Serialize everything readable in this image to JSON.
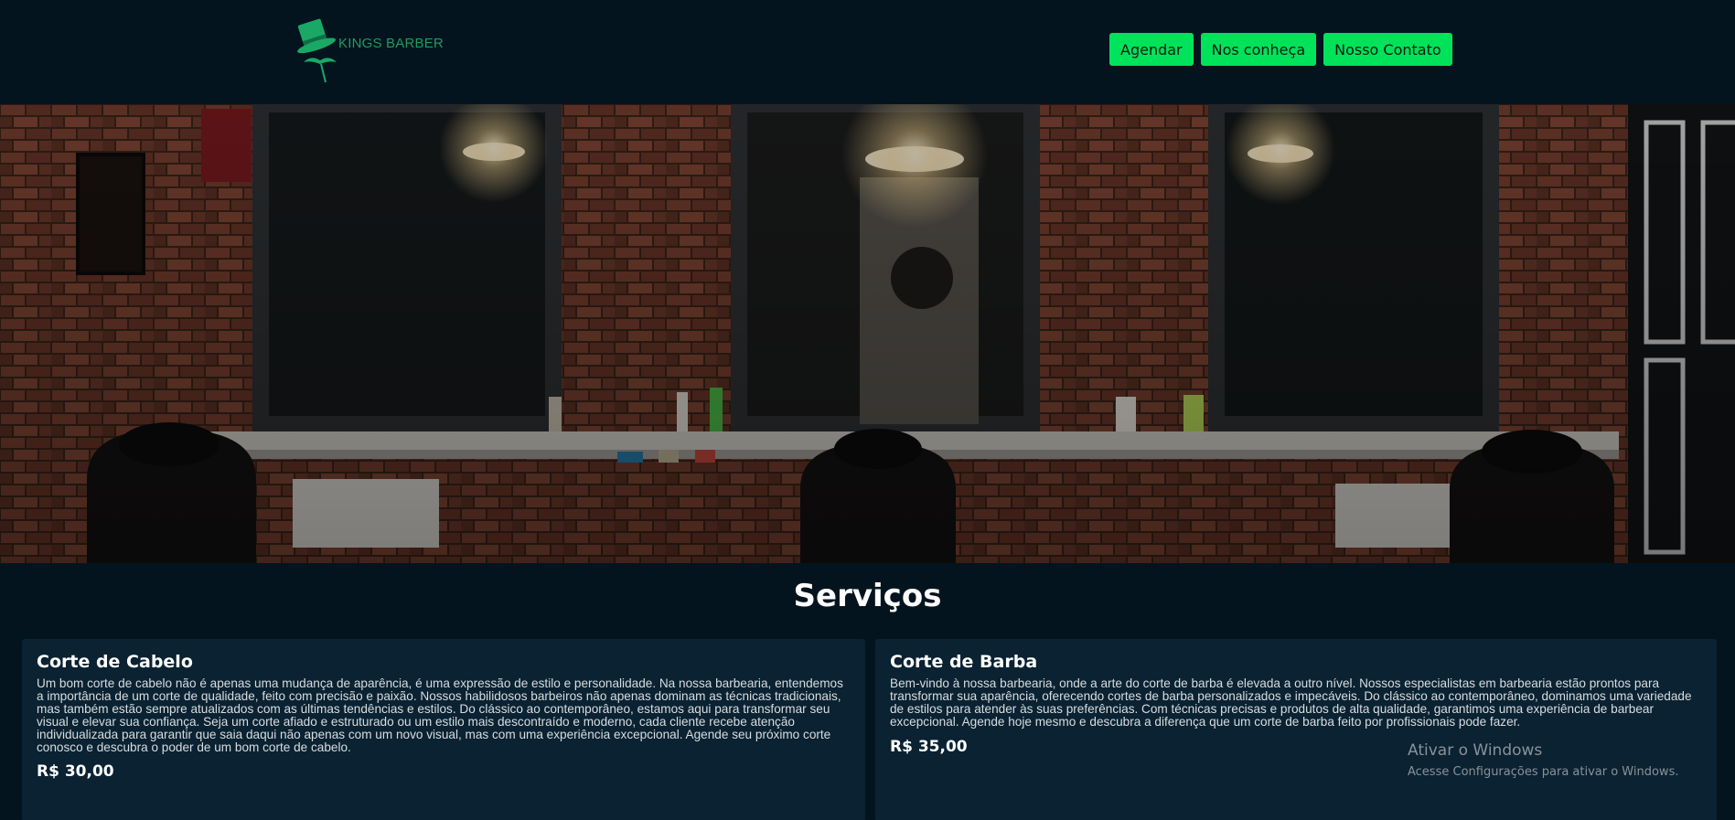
{
  "brand": {
    "name": "KINGS BARBER",
    "color": "#1f9b5e"
  },
  "nav": {
    "items": [
      {
        "label": "Agendar"
      },
      {
        "label": "Nos conheça"
      },
      {
        "label": "Nosso Contato"
      }
    ],
    "button_color": "#00e25a"
  },
  "hero": {
    "image_alt": "Barber shop interior with brick walls, mirrors, lamps and barber chairs"
  },
  "services": {
    "title": "Serviços",
    "cards": [
      {
        "title": "Corte de Cabelo",
        "description": "Um bom corte de cabelo não é apenas uma mudança de aparência, é uma expressão de estilo e personalidade. Na nossa barbearia, entendemos a importância de um corte de qualidade, feito com precisão e paixão. Nossos habilidosos barbeiros não apenas dominam as técnicas tradicionais, mas também estão sempre atualizados com as últimas tendências e estilos. Do clássico ao contemporâneo, estamos aqui para transformar seu visual e elevar sua confiança. Seja um corte afiado e estruturado ou um estilo mais descontraído e moderno, cada cliente recebe atenção individualizada para garantir que saia daqui não apenas com um novo visual, mas com uma experiência excepcional. Agende seu próximo corte conosco e descubra o poder de um bom corte de cabelo.",
        "price": "R$ 30,00"
      },
      {
        "title": "Corte de Barba",
        "description": "Bem-vindo à nossa barbearia, onde a arte do corte de barba é elevada a outro nível. Nossos especialistas em barbearia estão prontos para transformar sua aparência, oferecendo cortes de barba personalizados e impecáveis. Do clássico ao contemporâneo, dominamos uma variedade de estilos para atender às suas preferências. Com técnicas precisas e produtos de alta qualidade, garantimos uma experiência de barbear excepcional. Agende hoje mesmo e descubra a diferença que um corte de barba feito por profissionais pode fazer.",
        "price": "R$ 35,00"
      }
    ]
  },
  "watermark": {
    "title": "Ativar o Windows",
    "subtitle": "Acesse Configurações para ativar o Windows."
  }
}
